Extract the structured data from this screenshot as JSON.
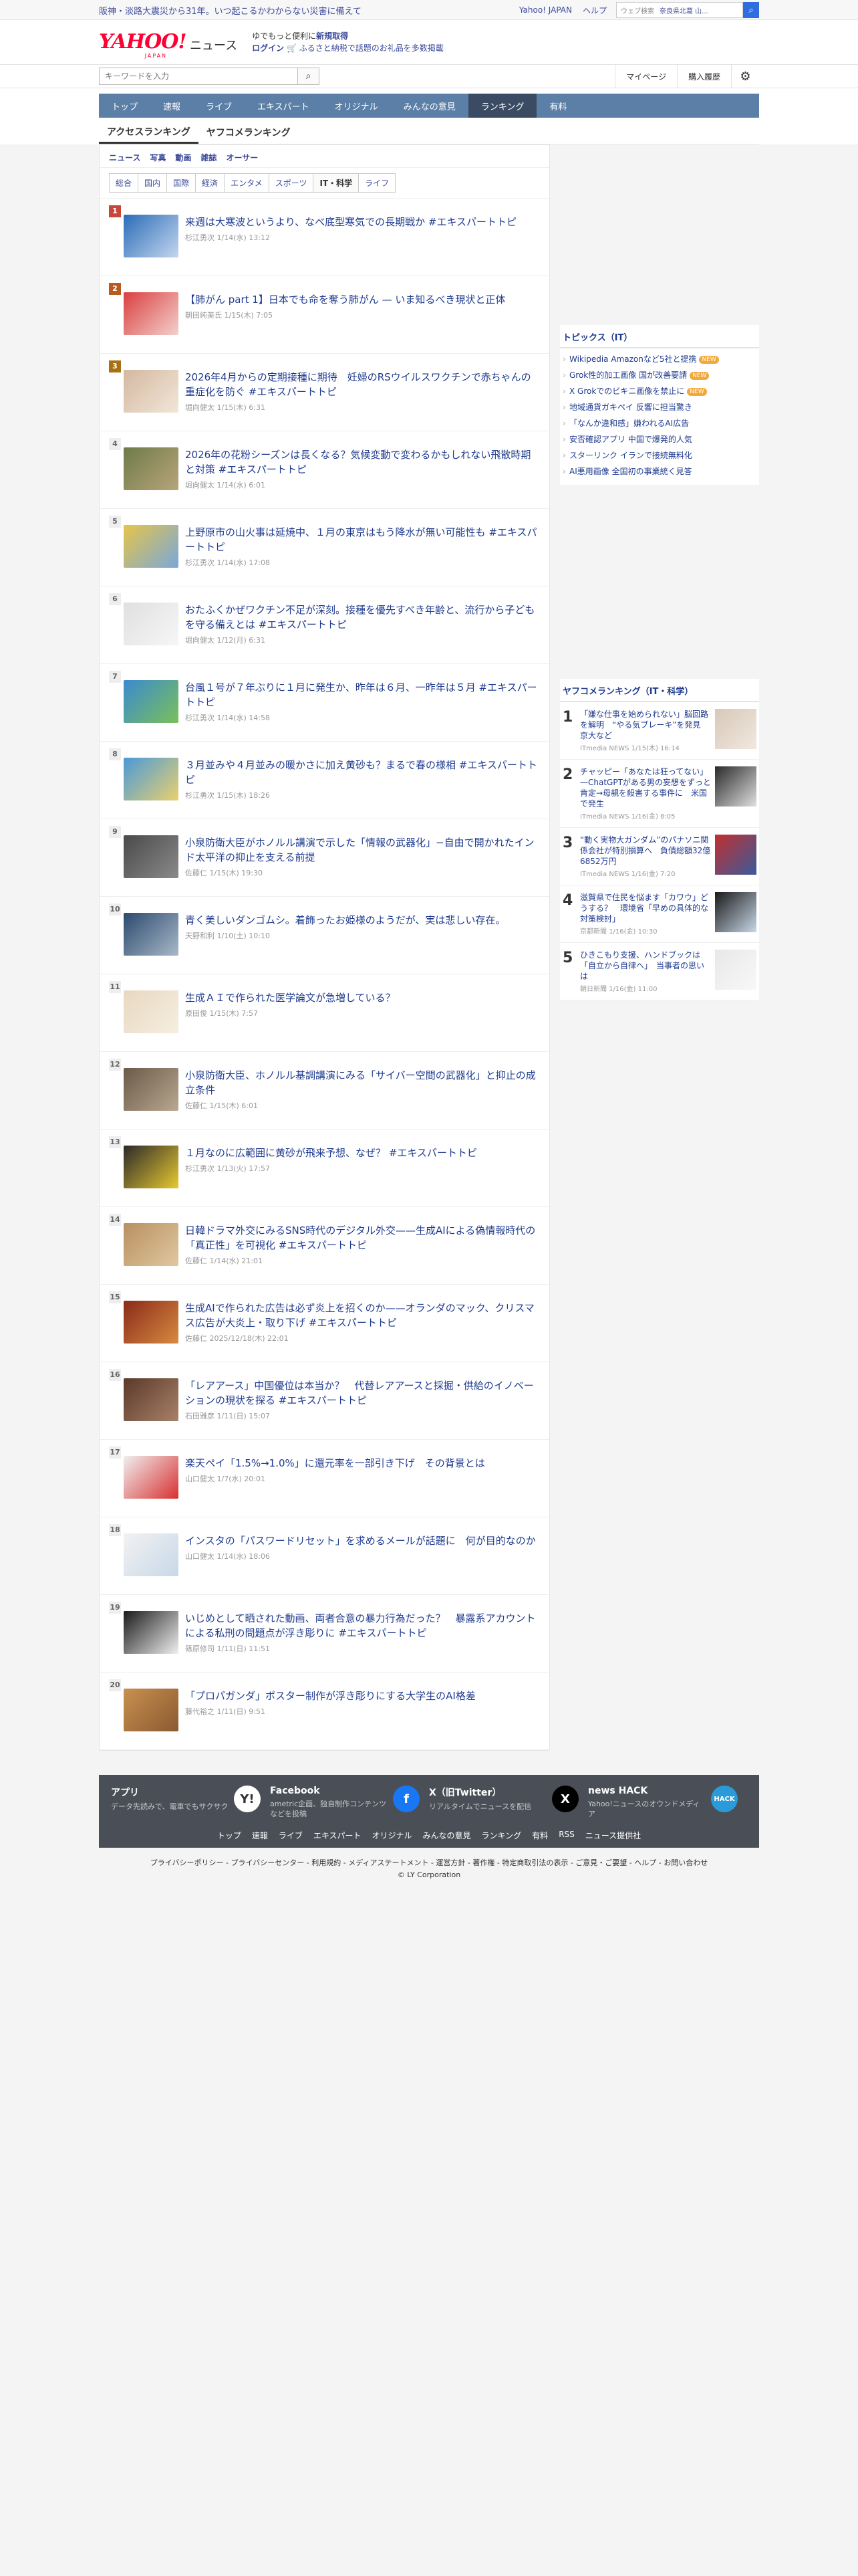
{
  "notice": {
    "text": "阪神・淡路大震災から31年。いつ起こるかわからない災害に備えて",
    "links": [
      "Yahoo! JAPAN",
      "ヘルプ"
    ],
    "search_placeholder": "ウェブ検索",
    "location": "奈良県北葛 山..."
  },
  "header": {
    "logo": "YAHOO!",
    "logo_sub": "JAPAN",
    "service": "ニュース",
    "promo_line1_a": "ゆでもっと便利に",
    "promo_line1_b": "新規取得",
    "promo_line2_a": "ログイン",
    "promo_line2_b": "ふるさと納税で話題のお礼品を多数掲載"
  },
  "search": {
    "placeholder": "キーワードを入力",
    "mypage": "マイページ",
    "history": "購入履歴"
  },
  "nav": [
    "トップ",
    "速報",
    "ライブ",
    "エキスパート",
    "オリジナル",
    "みんなの意見",
    "ランキング",
    "有料"
  ],
  "subtabs": [
    "アクセスランキング",
    "ヤフコメランキング"
  ],
  "cats": [
    "ニュース",
    "写真",
    "動画",
    "雑誌",
    "オーサー"
  ],
  "genres": [
    "総合",
    "国内",
    "国際",
    "経済",
    "エンタメ",
    "スポーツ",
    "IT・科学",
    "ライフ"
  ],
  "ranking": [
    {
      "num": "1",
      "title": "来週は大寒波というより、なべ底型寒気での長期戦か #エキスパートトピ",
      "author": "杉江勇次",
      "date": "1/14(水) 13:12",
      "c1": "#2b6cb8",
      "c2": "#c4d6ee"
    },
    {
      "num": "2",
      "title": "【肺がん part 1】日本でも命を奪う肺がん — いま知るべき現状と正体",
      "author": "朝田純美氏",
      "date": "1/15(木) 7:05",
      "c1": "#d94040",
      "c2": "#f4d0cc"
    },
    {
      "num": "3",
      "title": "2026年4月からの定期接種に期待　妊婦のRSウイルスワクチンで赤ちゃんの重症化を防ぐ #エキスパートトピ",
      "author": "堀向健太",
      "date": "1/15(木) 6:31",
      "c1": "#d4b8a0",
      "c2": "#f2e6d8"
    },
    {
      "num": "4",
      "title": "2026年の花粉シーズンは長くなる？気候変動で変わるかもしれない飛散時期と対策 #エキスパートトピ",
      "author": "堀向健太",
      "date": "1/14(水) 6:01",
      "c1": "#6f7a4a",
      "c2": "#b7a57a"
    },
    {
      "num": "5",
      "title": "上野原市の山火事は延焼中、１月の東京はもう降水が無い可能性も #エキスパートトピ",
      "author": "杉江勇次",
      "date": "1/14(水) 17:08",
      "c1": "#e6c44a",
      "c2": "#7aa8d8"
    },
    {
      "num": "6",
      "title": "おたふくかぜワクチン不足が深刻。接種を優先すべき年齢と、流行から子どもを守る備えとは #エキスパートトピ",
      "author": "堀向健太",
      "date": "1/12(月) 6:31",
      "c1": "#e0e0e0",
      "c2": "#f6f6f6"
    },
    {
      "num": "7",
      "title": "台風１号が７年ぶりに１月に発生か、昨年は６月、一昨年は５月 #エキスパートトピ",
      "author": "杉江勇次",
      "date": "1/14(水) 14:58",
      "c1": "#3a8ad0",
      "c2": "#7bc05a"
    },
    {
      "num": "8",
      "title": "３月並みや４月並みの暖かさに加え黄砂も？まるで春の様相 #エキスパートトピ",
      "author": "杉江勇次",
      "date": "1/15(木) 18:26",
      "c1": "#4a9ad8",
      "c2": "#e8d070"
    },
    {
      "num": "9",
      "title": "小泉防衛大臣がホノルル講演で示した「情報の武器化」−自由で開かれたインド太平洋の抑止を支える前提",
      "author": "佐藤仁",
      "date": "1/15(木) 19:30",
      "c1": "#4a4a4a",
      "c2": "#8a8a8a"
    },
    {
      "num": "10",
      "title": "青く美しいダンゴムシ。着飾ったお姫様のようだが、実は悲しい存在。",
      "author": "天野和利",
      "date": "1/10(土) 10:10",
      "c1": "#2c4a6e",
      "c2": "#a8b8c8"
    },
    {
      "num": "11",
      "title": "生成ＡＩで作られた医学論文が急増している？",
      "author": "原田俊",
      "date": "1/15(木) 7:57",
      "c1": "#e8d8c0",
      "c2": "#f6eee0"
    },
    {
      "num": "12",
      "title": "小泉防衛大臣、ホノルル基調講演にみる「サイバー空間の武器化」と抑止の成立条件",
      "author": "佐藤仁",
      "date": "1/15(木) 6:01",
      "c1": "#6a5a48",
      "c2": "#b8a890"
    },
    {
      "num": "13",
      "title": "１月なのに広範囲に黄砂が飛来予想、なぜ？ #エキスパートトピ",
      "author": "杉江勇次",
      "date": "1/13(火) 17:57",
      "c1": "#2a2a2a",
      "c2": "#e8c830"
    },
    {
      "num": "14",
      "title": "日韓ドラマ外交にみるSNS時代のデジタル外交——生成AIによる偽情報時代の「真正性」を可視化 #エキスパートトピ",
      "author": "佐藤仁",
      "date": "1/14(水) 21:01",
      "c1": "#b89060",
      "c2": "#e0c8a0"
    },
    {
      "num": "15",
      "title": "生成AIで作られた広告は必ず炎上を招くのか——オランダのマック、クリスマス広告が大炎上・取り下げ #エキスパートトピ",
      "author": "佐藤仁",
      "date": "2025/12/18(木) 22:01",
      "c1": "#8a2a1a",
      "c2": "#d88a40"
    },
    {
      "num": "16",
      "title": "「レアアース」中国優位は本当か？　代替レアアースと採掘・供給のイノベーションの現状を探る #エキスパートトピ",
      "author": "石田雅彦",
      "date": "1/11(日) 15:07",
      "c1": "#5a3a2a",
      "c2": "#a88068"
    },
    {
      "num": "17",
      "title": "楽天ペイ「1.5%→1.0%」に還元率を一部引き下げ　その背景とは",
      "author": "山口健太",
      "date": "1/7(水) 20:01",
      "c1": "#f0f0f0",
      "c2": "#d83030"
    },
    {
      "num": "18",
      "title": "インスタの「パスワードリセット」を求めるメールが話題に　何が目的なのか",
      "author": "山口健太",
      "date": "1/14(水) 18:06",
      "c1": "#f2f2f2",
      "c2": "#c8d8e8"
    },
    {
      "num": "19",
      "title": "いじめとして晒された動画、両者合意の暴力行為だった？　暴露系アカウントによる私刑の問題点が浮き彫りに #エキスパートトピ",
      "author": "篠原修司",
      "date": "1/11(日) 11:51",
      "c1": "#1a1a1a",
      "c2": "#f0f0f0"
    },
    {
      "num": "20",
      "title": "「プロパガンダ」ポスター制作が浮き彫りにする大学生のAI格差",
      "author": "藤代裕之",
      "date": "1/11(日) 9:51",
      "c1": "#c89050",
      "c2": "#8a5a30"
    }
  ],
  "topics": {
    "title": "トピックス（IT）",
    "items": [
      {
        "text": "Wikipedia Amazonなど5社と提携",
        "new": true
      },
      {
        "text": "Grok性的加工画像 国が改善要請",
        "new": true
      },
      {
        "text": "X Grokでのビキニ画像を禁止に",
        "new": true
      },
      {
        "text": "地域通貨ガキペイ 反響に担当驚き",
        "new": false
      },
      {
        "text": "「なんか違和感」嫌われるAI広告",
        "new": false
      },
      {
        "text": "安否確認アプリ 中国で爆発的人気",
        "new": false
      },
      {
        "text": "スターリンク イランで接続無料化",
        "new": false
      },
      {
        "text": "AI悪用画像 全国初の事業統く見答",
        "new": false
      }
    ],
    "new_label": "NEW"
  },
  "side_ranking": {
    "title": "ヤフコメランキング（IT・科学）",
    "items": [
      {
        "num": "1",
        "title": "「嫌な仕事を始められない」脳回路を解明　“やる気ブレーキ”を発見　京大など",
        "meta": "ITmedia NEWS 1/15(木) 16:14",
        "c1": "#d8c8b8",
        "c2": "#f0e8e0"
      },
      {
        "num": "2",
        "title": "チャッピー「あなたは狂ってない」—ChatGPTがある男の妄想をずっと肯定→母親を殺害する事件に　米国で発生",
        "meta": "ITmedia NEWS 1/16(金) 8:05",
        "c1": "#2a2a2a",
        "c2": "#e0e0e0"
      },
      {
        "num": "3",
        "title": "“動く実物大ガンダム”のパナソニ関係会社が特別損算へ　負債総額32億6852万円",
        "meta": "ITmedia NEWS 1/16(金) 7:20",
        "c1": "#c03030",
        "c2": "#3a5a9a"
      },
      {
        "num": "4",
        "title": "滋賀県で住民を悩ます「カワウ」どうする？　環境省「早めの具体的な対策検討」",
        "meta": "京都新聞 1/16(金) 10:30",
        "c1": "#1a1a1a",
        "c2": "#c8d8e8"
      },
      {
        "num": "5",
        "title": "ひきこもり支援、ハンドブックは「自立から自律へ」　当事者の思いは",
        "meta": "朝日新聞 1/16(金) 11:00",
        "c1": "#e8e8e8",
        "c2": "#f8f8f8"
      }
    ]
  },
  "footer": {
    "cards": [
      {
        "title": "アプリ",
        "desc": "データ先読みで、電車でもサクサク",
        "icon": "Y!",
        "color": "#ffffff",
        "fg": "#333333"
      },
      {
        "title": "Facebook",
        "desc": "ametric企画、独自制作コンテンツなどを投稿",
        "icon": "f",
        "color": "#1877f2",
        "fg": "#ffffff"
      },
      {
        "title": "X（旧Twitter）",
        "desc": "リアルタイムでニュースを配信",
        "icon": "X",
        "color": "#000000",
        "fg": "#ffffff"
      },
      {
        "title": "news HACK",
        "desc": "Yahoo!ニュースのオウンドメディア",
        "icon": "HACK",
        "color": "#2a9ad8",
        "fg": "#ffffff"
      }
    ],
    "links": [
      "トップ",
      "速報",
      "ライブ",
      "エキスパート",
      "オリジナル",
      "みんなの意見",
      "ランキング",
      "有料",
      "RSS",
      "ニュース提供社"
    ],
    "legal": "プライバシーポリシー - プライバシーセンター - 利用規約 - メディアステートメント - 運営方針 - 著作権 - 特定商取引法の表示 - ご意見・ご要望 - ヘルプ - お問い合わせ",
    "copyright": "© LY Corporation"
  }
}
